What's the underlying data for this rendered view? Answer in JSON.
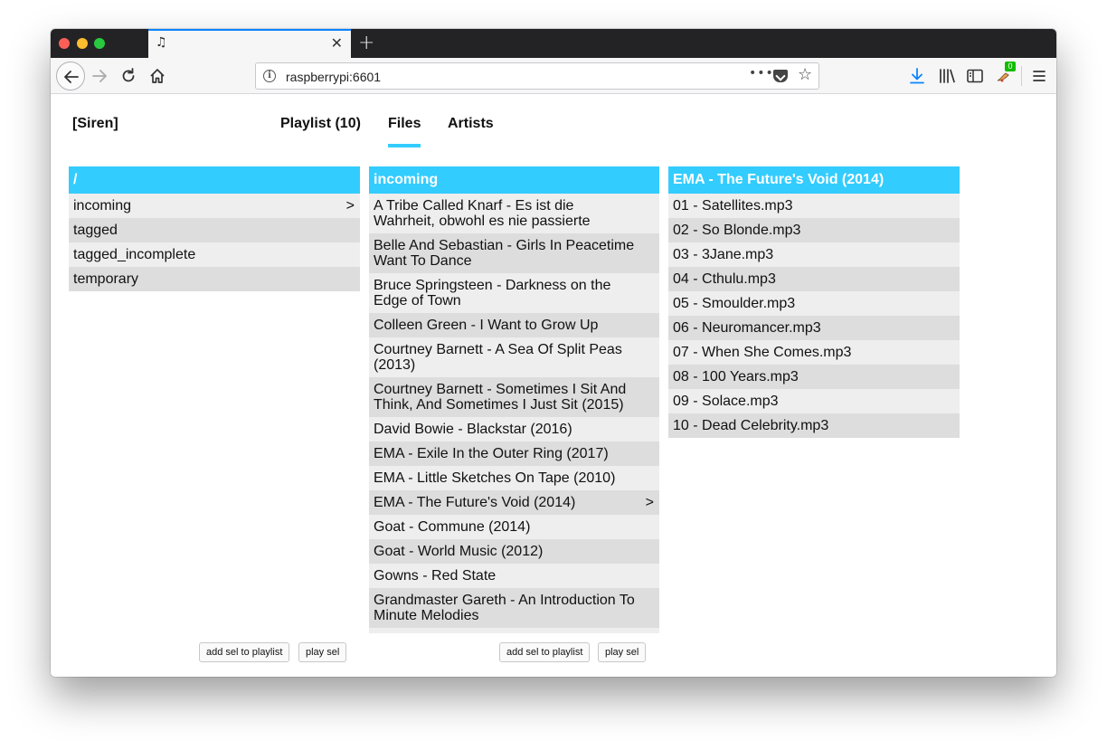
{
  "browser": {
    "tab_icon": "music-note-icon",
    "url": "raspberrypi:6601",
    "extension_badge": "0"
  },
  "app": {
    "brand": "[Siren]",
    "tabs": [
      {
        "label": "Playlist (10)",
        "active": false
      },
      {
        "label": "Files",
        "active": true
      },
      {
        "label": "Artists",
        "active": false
      }
    ],
    "accent_color": "#33ccff"
  },
  "columns": [
    {
      "header": "/",
      "items": [
        {
          "label": "incoming",
          "arrow": ">"
        },
        {
          "label": "tagged",
          "arrow": ""
        },
        {
          "label": "tagged_incomplete",
          "arrow": ""
        },
        {
          "label": "temporary",
          "arrow": ""
        }
      ],
      "buttons": {
        "add": "add sel to playlist",
        "play": "play sel"
      }
    },
    {
      "header": "incoming",
      "items": [
        {
          "label": "A Tribe Called Knarf - Es ist die Wahrheit, obwohl es nie passierte",
          "arrow": ""
        },
        {
          "label": "Belle And Sebastian - Girls In Peacetime Want To Dance",
          "arrow": ""
        },
        {
          "label": "Bruce Springsteen - Darkness on the Edge of Town",
          "arrow": ""
        },
        {
          "label": "Colleen Green - I Want to Grow Up",
          "arrow": ""
        },
        {
          "label": "Courtney Barnett - A Sea Of Split Peas (2013)",
          "arrow": ""
        },
        {
          "label": "Courtney Barnett - Sometimes I Sit And Think, And Sometimes I Just Sit (2015)",
          "arrow": ""
        },
        {
          "label": "David Bowie - Blackstar (2016)",
          "arrow": ""
        },
        {
          "label": "EMA - Exile In the Outer Ring (2017)",
          "arrow": ""
        },
        {
          "label": "EMA - Little Sketches On Tape (2010)",
          "arrow": ""
        },
        {
          "label": "EMA - The Future's Void (2014)",
          "arrow": ">"
        },
        {
          "label": "Goat - Commune (2014)",
          "arrow": ""
        },
        {
          "label": "Goat - World Music (2012)",
          "arrow": ""
        },
        {
          "label": "Gowns - Red State",
          "arrow": ""
        },
        {
          "label": "Grandmaster Gareth - An Introduction To Minute Melodies",
          "arrow": ""
        },
        {
          "label": "",
          "arrow": ""
        }
      ],
      "buttons": {
        "add": "add sel to playlist",
        "play": "play sel"
      }
    },
    {
      "header": "EMA - The Future's Void (2014)",
      "items": [
        {
          "label": "01 - Satellites.mp3",
          "arrow": ""
        },
        {
          "label": "02 - So Blonde.mp3",
          "arrow": ""
        },
        {
          "label": "03 - 3Jane.mp3",
          "arrow": ""
        },
        {
          "label": "04 - Cthulu.mp3",
          "arrow": ""
        },
        {
          "label": "05 - Smoulder.mp3",
          "arrow": ""
        },
        {
          "label": "06 - Neuromancer.mp3",
          "arrow": ""
        },
        {
          "label": "07 - When She Comes.mp3",
          "arrow": ""
        },
        {
          "label": "08 - 100 Years.mp3",
          "arrow": ""
        },
        {
          "label": "09 - Solace.mp3",
          "arrow": ""
        },
        {
          "label": "10 - Dead Celebrity.mp3",
          "arrow": ""
        }
      ]
    }
  ]
}
